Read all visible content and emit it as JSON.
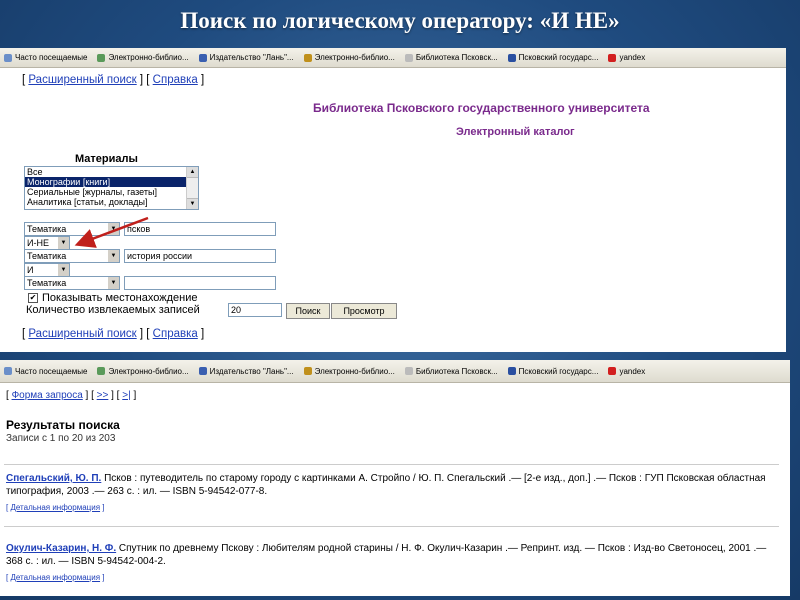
{
  "slide": {
    "title": "Поиск по логическому оператору: «И НЕ»"
  },
  "favorites": [
    "Часто посещаемые",
    "Электронно-библио...",
    "Издательство \"Лань\"...",
    "Электронно-библио...",
    "Библиотека Псковск...",
    "Псковский государс...",
    "yandex"
  ],
  "favorites2": [
    "Часто посещаемые",
    "Электронно-библио...",
    "Издательство \"Лань\"...",
    "Электронно-библио...",
    "Библиотека Псковск...",
    "Псковский государс...",
    "yandex"
  ],
  "top_links": {
    "advanced": "Расширенный поиск",
    "help": "Справка"
  },
  "library": {
    "title": "Библиотека Псковского государственного университета",
    "catalog": "Электронный каталог"
  },
  "materials": {
    "label": "Материалы",
    "options": [
      "Все",
      "Монографии [книги]",
      "Сериальные [журналы, газеты]",
      "Аналитика [статьи, доклады]"
    ],
    "selected": "Монографии [книги]"
  },
  "search_rows": {
    "field1": "Тематика",
    "value1": "псков",
    "op1": "И-НЕ",
    "field2": "Тематика",
    "value2": "история россии",
    "op2": "И",
    "field3": "Тематика",
    "value3": ""
  },
  "options": {
    "show_location": "Показывать местонахождение",
    "count_label": "Количество извлекаемых записей",
    "count_value": "20",
    "search_button": "Поиск",
    "view_button": "Просмотр"
  },
  "bottom_links": {
    "advanced": "Расширенный поиск",
    "help": "Справка"
  },
  "results_nav": {
    "form": "Форма запроса",
    "next": ">>",
    "last": ">|"
  },
  "results": {
    "title": "Результаты поиска",
    "subtitle": "Записи с 1 по 20 из 203",
    "records": [
      {
        "author": "Спегальский, Ю. П.",
        "text": "Псков : путеводитель по старому городу с картинками А. Стройпо / Ю. П. Спегальский .— [2-е изд., доп.] .— Псков : ГУП Псковская областная типография, 2003 .— 263 с. : ил. — ISBN 5-94542-077-8.",
        "detail": "Детальная информация"
      },
      {
        "author": "Окулич-Казарин, Н. Ф.",
        "text": "Спутник по древнему Пскову : Любителям родной старины / Н. Ф. Окулич-Казарин .— Репринт. изд. — Псков : Изд-во Светоносец, 2001 .— 368 с. : ил. — ISBN 5-94542-004-2.",
        "detail": "Детальная информация"
      }
    ]
  },
  "colors": {
    "slide_bg": "#1f4b7f",
    "link": "#1f3fb8",
    "heading": "#7a2a8c",
    "arrow": "#c0201c"
  }
}
